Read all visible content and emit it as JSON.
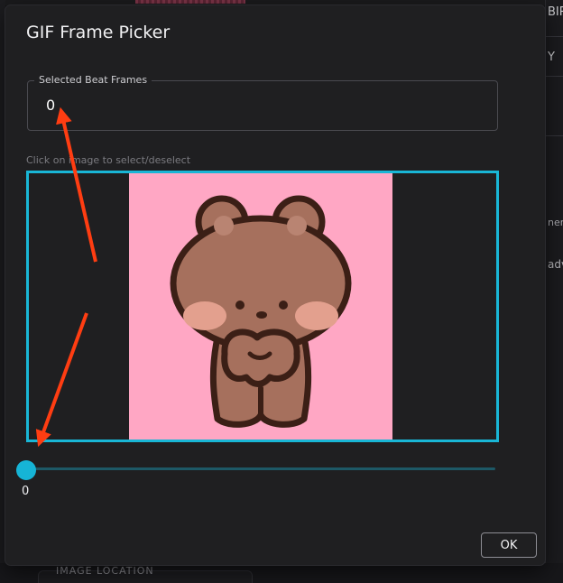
{
  "background": {
    "right_edge_texts": [
      "BIR",
      "Y",
      "nen",
      "adv"
    ],
    "bottom_label": "IMAGE LOCATION"
  },
  "dialog": {
    "title": "GIF Frame Picker",
    "selected_frames": {
      "label": "Selected Beat Frames",
      "value": "0"
    },
    "hint": "Click on image to select/deselect",
    "slider": {
      "value": "0",
      "position": 0
    },
    "ok_label": "OK"
  },
  "colors": {
    "accent": "#19b6d6",
    "annotation_arrow": "#ff3d12",
    "frame_background": "#ffa7c4",
    "dialog_background": "#1f1f21"
  },
  "icons": {
    "image_content": "brown-bear-sticker"
  }
}
